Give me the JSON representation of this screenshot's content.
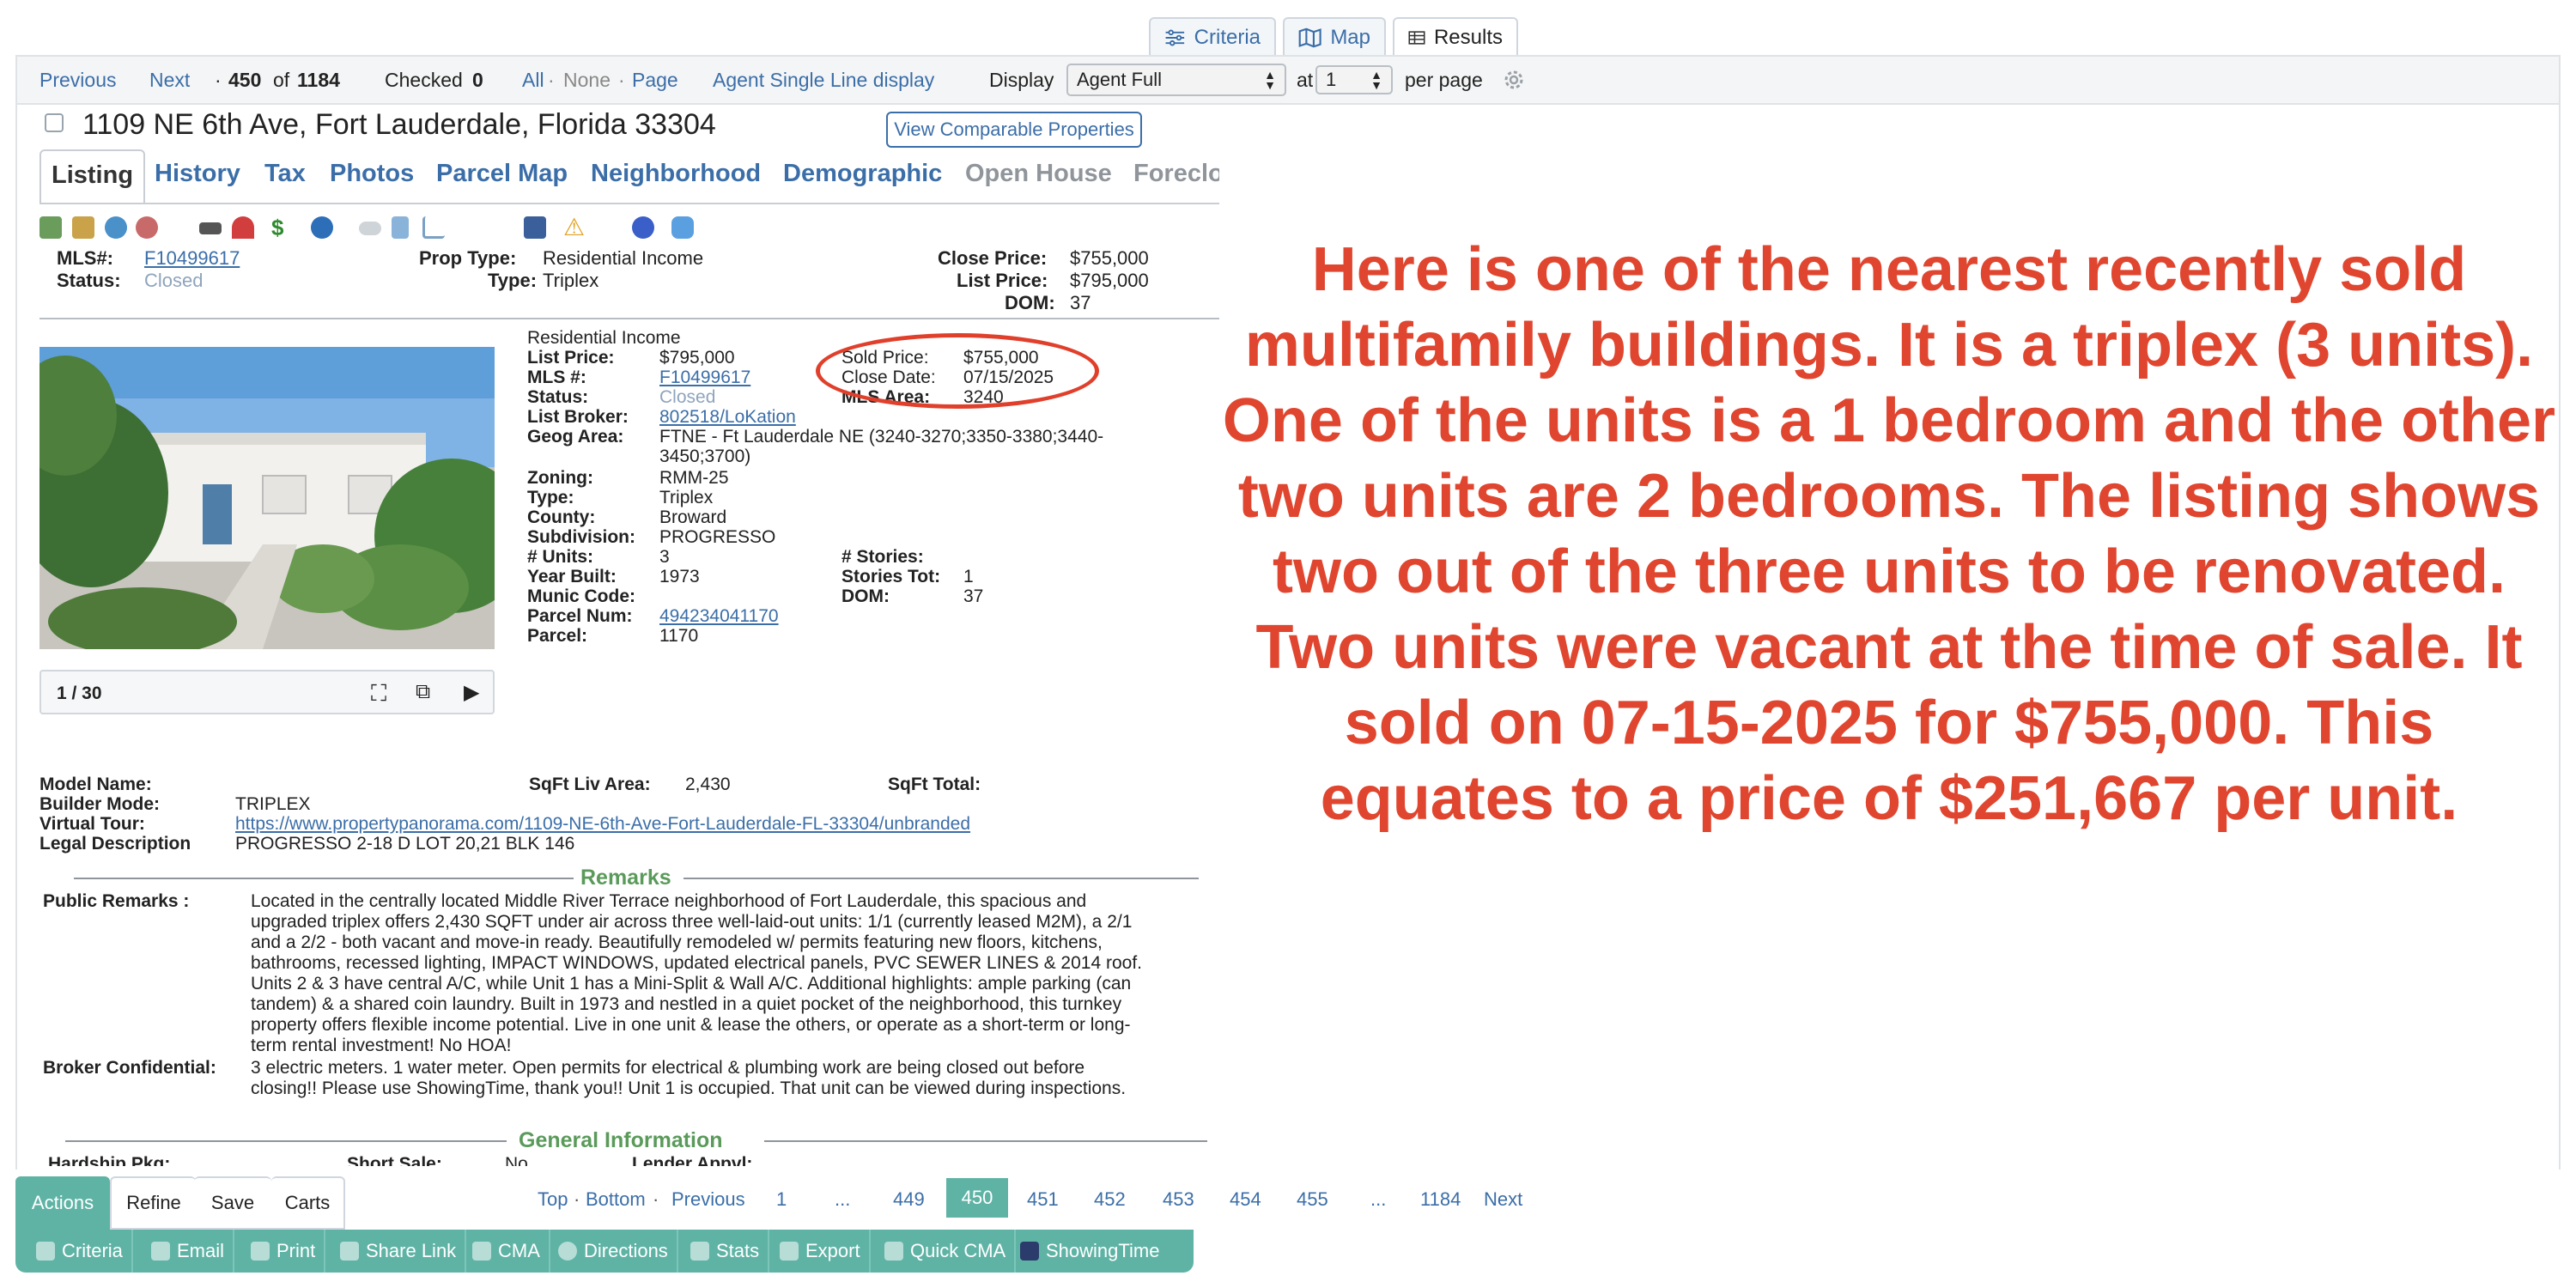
{
  "view_tabs": [
    {
      "label": "Criteria",
      "icon": "sliders-icon"
    },
    {
      "label": "Map",
      "icon": "map-icon"
    },
    {
      "label": "Results",
      "icon": "grid-icon"
    }
  ],
  "nav": {
    "previous": "Previous",
    "next": "Next",
    "position_prefix": "·",
    "current": "450",
    "of_word": "of",
    "total": "1184",
    "checked_label": "Checked",
    "checked_count": "0",
    "all": "All",
    "dot": "·",
    "none": "None",
    "page": "Page",
    "agent_single_line": "Agent Single Line display",
    "display_label": "Display",
    "display_value": "Agent Full",
    "at_label": "at",
    "per_page_value": "1",
    "per_page_label": "per page"
  },
  "listing": {
    "address": "1109 NE 6th Ave, Fort Lauderdale, Florida 33304",
    "comparable_button": "View Comparable Properties",
    "tabs": [
      "Listing",
      "History",
      "Tax",
      "Photos",
      "Parcel Map",
      "Neighborhood",
      "Demographic",
      "Open House",
      "Foreclo"
    ],
    "summary": {
      "mls_label": "MLS#:",
      "mls": "F10499617",
      "status_label": "Status:",
      "status": "Closed",
      "prop_type_label": "Prop Type:",
      "prop_type": "Residential Income",
      "type_label": "Type:",
      "type": "Triplex",
      "close_price_label": "Close Price:",
      "close_price": "$755,000",
      "list_price_label": "List Price:",
      "list_price": "$795,000",
      "dom_label": "DOM:",
      "dom": "37"
    },
    "detail": {
      "category": "Residential Income",
      "list_price_label": "List Price:",
      "list_price": "$795,000",
      "mls_label": "MLS #:",
      "mls": "F10499617",
      "status_label": "Status:",
      "status": "Closed",
      "list_broker_label": "List Broker:",
      "list_broker": "802518/LoKation",
      "geog_area_label": "Geog Area:",
      "geog_area_line1": "FTNE - Ft Lauderdale NE (3240-3270;3350-3380;3440-",
      "geog_area_line2": "3450;3700)",
      "zoning_label": "Zoning:",
      "zoning": "RMM-25",
      "type_label": "Type:",
      "type": "Triplex",
      "county_label": "County:",
      "county": "Broward",
      "subdivision_label": "Subdivision:",
      "subdivision": "PROGRESSO",
      "units_label": "# Units:",
      "units": "3",
      "year_built_label": "Year Built:",
      "year_built": "1973",
      "munic_code_label": "Munic Code:",
      "parcel_num_label": "Parcel Num:",
      "parcel_num": "494234041170",
      "parcel_label": "Parcel:",
      "parcel": "1170",
      "sold_price_label": "Sold Price:",
      "sold_price": "$755,000",
      "close_date_label": "Close Date:",
      "close_date": "07/15/2025",
      "mls_area_label": "MLS Area:",
      "mls_area": "3240",
      "stories_label": "# Stories:",
      "stories_tot_label": "Stories Tot:",
      "stories_tot": "1",
      "dom_label": "DOM:",
      "dom": "37"
    },
    "photo_counter": "1 / 30",
    "extra": {
      "model_name_label": "Model Name:",
      "builder_mode_label": "Builder Mode:",
      "builder_mode": "TRIPLEX",
      "virtual_tour_label": "Virtual Tour:",
      "virtual_tour": "https://www.propertypanorama.com/1109-NE-6th-Ave-Fort-Lauderdale-FL-33304/unbranded",
      "legal_label": "Legal Description",
      "legal": "PROGRESSO 2-18 D LOT 20,21 BLK 146",
      "sqft_liv_label": "SqFt Liv Area:",
      "sqft_liv": "2,430",
      "sqft_total_label": "SqFt Total:"
    },
    "remarks_heading": "Remarks",
    "public_remarks_label": "Public Remarks :",
    "public_remarks": [
      "Located in the centrally located Middle River Terrace neighborhood of Fort Lauderdale, this spacious and",
      "upgraded triplex offers 2,430 SQFT under air across three well-laid-out units: 1/1 (currently leased M2M), a 2/1",
      "and a 2/2 - both vacant and move-in ready. Beautifully remodeled w/ permits featuring new floors, kitchens,",
      "bathrooms, recessed lighting, IMPACT WINDOWS, updated electrical panels, PVC SEWER LINES & 2014 roof.",
      "Units 2 & 3 have central A/C, while Unit 1 has a Mini-Split & Wall A/C. Additional highlights: ample parking (can",
      "tandem) & a shared coin laundry. Built in 1973 and nestled in a quiet pocket of the neighborhood, this turnkey",
      "property offers flexible income potential. Live in one unit & lease the others, or operate as a short-term or long-",
      "term rental investment! No HOA!"
    ],
    "broker_confidential_label": "Broker Confidential:",
    "broker_confidential": [
      "3 electric meters. 1 water meter. Open permits for electrical & plumbing work are being closed out before",
      "closing!! Please use ShowingTime, thank you!! Unit 1 is occupied. That unit can be viewed during inspections."
    ],
    "general_heading": "General Information",
    "cut_off": {
      "hardship_label": "Hardship Pkg:",
      "short_sale_label": "Short Sale:",
      "short_sale": "No",
      "lender_label": "Lender Appvl:"
    }
  },
  "annotation": "Here is one of the nearest recently sold multifamily buildings. It is a triplex (3 units). One of the units is a 1 bedroom and the other two units are 2 bedrooms. The listing shows two out of the three units to be renovated. Two units were vacant at the time of sale. It sold on 07-15-2025 for $755,000. This equates to a price of $251,667 per unit.",
  "pager": {
    "top": "Top",
    "dot": "·",
    "bottom": "Bottom",
    "previous": "Previous",
    "pages": [
      "1",
      "...",
      "449",
      "450",
      "451",
      "452",
      "453",
      "454",
      "455",
      "...",
      "1184"
    ],
    "next": "Next"
  },
  "actions": {
    "tabs": [
      "Actions",
      "Refine",
      "Save",
      "Carts"
    ],
    "buttons": [
      "Criteria",
      "Email",
      "Print",
      "Share Link",
      "CMA",
      "Directions",
      "Stats",
      "Export",
      "Quick CMA",
      "ShowingTime"
    ]
  },
  "colors": {
    "accent": "#5fb3a5",
    "link": "#3b6ea8",
    "annotation": "#e0462f",
    "closed": "#8fa4bd",
    "section_green": "#5a9a5a"
  }
}
